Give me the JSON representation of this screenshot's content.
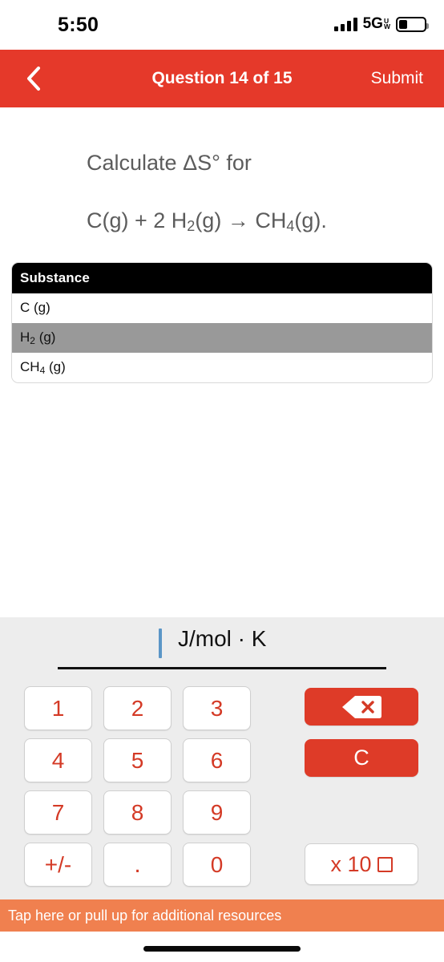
{
  "status_bar": {
    "time": "5:50",
    "network_label": "5G",
    "network_sub_top": "U",
    "network_sub_bottom": "W",
    "signal_icon": "cellular-signal-icon",
    "battery_icon": "battery-icon",
    "battery_level_percent": 32
  },
  "nav_bar": {
    "back_icon": "chevron-left-icon",
    "title": "Question 14 of 15",
    "submit_label": "Submit",
    "background_color": "#e5392a"
  },
  "question": {
    "prompt": "Calculate ΔS° for",
    "equation_prefix": "C(g) + 2 H",
    "equation_sub1": "2",
    "equation_mid": "(g) → CH",
    "equation_sub2": "4",
    "equation_suffix": "(g)."
  },
  "table": {
    "header": "Substance",
    "rows": [
      {
        "label_main": "C (g)",
        "sub": "",
        "label_tail": "",
        "shaded": false
      },
      {
        "label_main": "H",
        "sub": "2",
        "label_tail": " (g)",
        "shaded": true
      },
      {
        "label_main": "CH",
        "sub": "4",
        "label_tail": " (g)",
        "shaded": false
      }
    ]
  },
  "answer": {
    "value": "",
    "unit": "J/mol · K",
    "caret_visible": true,
    "caret_color": "#5b96c7"
  },
  "keypad": {
    "keys": [
      {
        "label": "1",
        "name": "key-1"
      },
      {
        "label": "2",
        "name": "key-2"
      },
      {
        "label": "3",
        "name": "key-3"
      },
      {
        "label": "4",
        "name": "key-4"
      },
      {
        "label": "5",
        "name": "key-5"
      },
      {
        "label": "6",
        "name": "key-6"
      },
      {
        "label": "7",
        "name": "key-7"
      },
      {
        "label": "8",
        "name": "key-8"
      },
      {
        "label": "9",
        "name": "key-9"
      },
      {
        "label": "+/-",
        "name": "key-sign"
      },
      {
        "label": ".",
        "name": "key-decimal"
      },
      {
        "label": "0",
        "name": "key-0"
      }
    ],
    "backspace_icon": "backspace-delete-icon",
    "clear_label": "C",
    "exponent_label": "x 10",
    "exponent_placeholder_icon": "empty-square-icon",
    "key_text_color": "#d43a26",
    "action_color": "#de3b28",
    "panel_color": "#ededed"
  },
  "resources_bar": {
    "text": "Tap here or pull up for additional resources",
    "background_color": "#f0804f"
  }
}
